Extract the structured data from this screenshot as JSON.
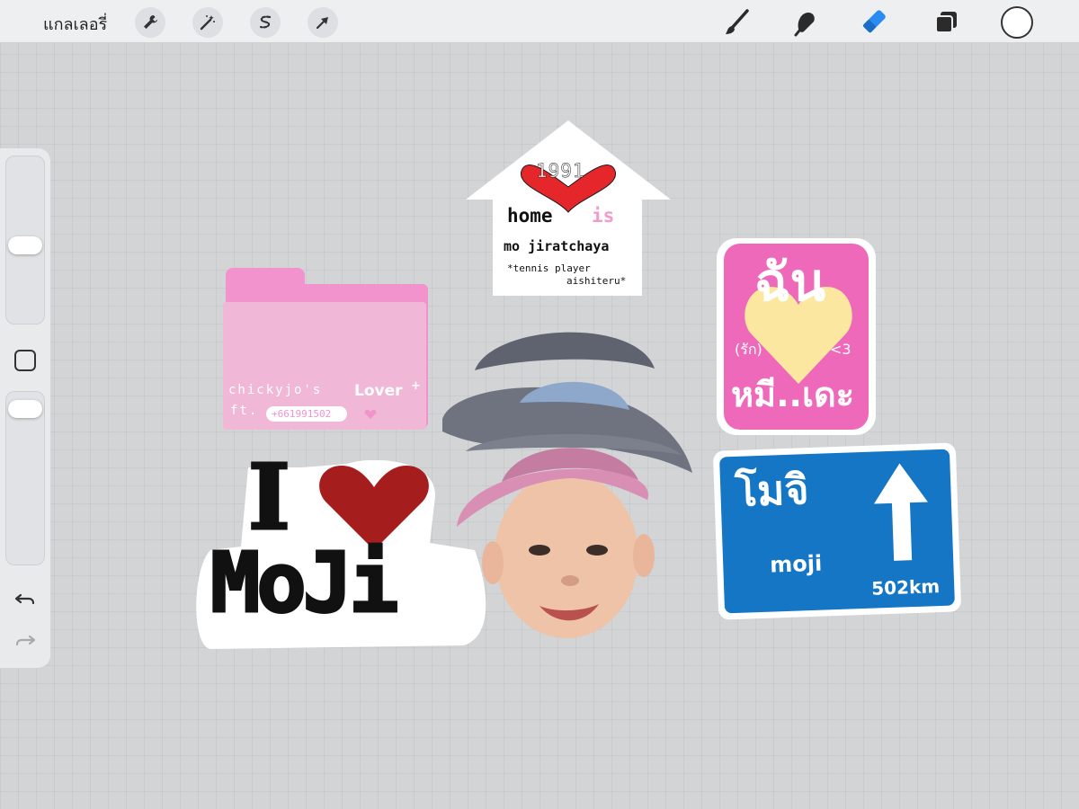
{
  "toolbar": {
    "gallery_label": "แกลเลอรี่",
    "left_tools": [
      "wrench-icon",
      "magic-wand-icon",
      "selection-icon",
      "transform-arrow-icon"
    ],
    "right_tools": [
      "brush-icon",
      "smudge-icon",
      "eraser-icon",
      "layers-icon"
    ],
    "active_tool": "eraser",
    "color_swatch": "#ffffff"
  },
  "sidebar": {
    "tools": [
      "brush-size-slider",
      "modify-button",
      "opacity-slider",
      "undo-icon",
      "redo-icon"
    ]
  },
  "stickers": {
    "folder": {
      "line1": "chickyjo's",
      "lover": "Lover",
      "ft": "ft.",
      "phone": "+661991502"
    },
    "house": {
      "year": "1991",
      "home": "home",
      "is": "is",
      "name": "mo jiratchaya",
      "line3": "*tennis player",
      "line4": "aishiteru*"
    },
    "pink_card": {
      "top": "ฉัน",
      "rak": "(รัก)",
      "mark": "<3",
      "bottom": "หมี..เดะ"
    },
    "i_love": {
      "i": "I",
      "name": "MoJi"
    },
    "road_sign": {
      "thai": "โมจิ",
      "en": "moji",
      "distance": "502km"
    }
  },
  "colors": {
    "canvas": "#d3d4d6",
    "pink": "#ee69b9",
    "folder_pink": "#f293ce",
    "heart_red": "#a51d1d",
    "sign_blue": "#1576c6",
    "eraser_blue": "#2a8cf0"
  }
}
